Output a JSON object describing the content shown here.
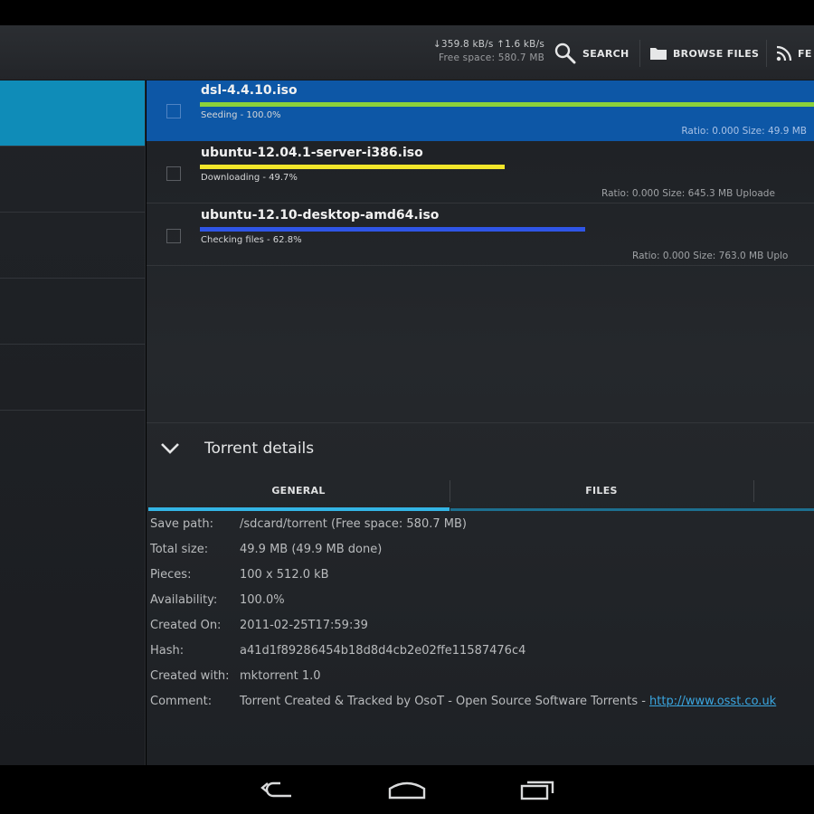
{
  "action_bar": {
    "speed": "↓359.8 kB/s ↑1.6 kB/s",
    "free_space": "Free space: 580.7 MB",
    "buttons": [
      {
        "label": "SEARCH",
        "icon": "search-icon"
      },
      {
        "label": "BROWSE FILES",
        "icon": "folder-icon"
      },
      {
        "label": "FE",
        "icon": "rss-feed-icon"
      }
    ]
  },
  "torrents": [
    {
      "name": "dsl-4.4.10.iso",
      "status": "Seeding - 100.0%",
      "meta": "Ratio: 0.000   Size: 49.9 MB",
      "progress": 1.0,
      "bar_color": "#8bd13a",
      "selected": true
    },
    {
      "name": "ubuntu-12.04.1-server-i386.iso",
      "status": "Downloading - 49.7%",
      "meta": "Ratio: 0.000   Size: 645.3 MB   Uploade",
      "progress": 0.497,
      "bar_color": "#f2e62a",
      "selected": false
    },
    {
      "name": "ubuntu-12.10-desktop-amd64.iso",
      "status": "Checking files - 62.8%",
      "meta": "Ratio: 0.000   Size: 763.0 MB   Uplo",
      "progress": 0.628,
      "bar_color": "#2f55e6",
      "selected": false
    }
  ],
  "details": {
    "title": "Torrent details",
    "tabs": [
      {
        "label": "GENERAL",
        "active": true
      },
      {
        "label": "FILES",
        "active": false
      }
    ],
    "rows": [
      {
        "label": "Save path:",
        "value": "/sdcard/torrent  (Free space: 580.7 MB)"
      },
      {
        "label": "Total size:",
        "value": "49.9 MB (49.9 MB done)"
      },
      {
        "label": "Pieces:",
        "value": "100 x 512.0 kB"
      },
      {
        "label": "Availability:",
        "value": "100.0%"
      },
      {
        "label": "Created On:",
        "value": "2011-02-25T17:59:39"
      },
      {
        "label": "Hash:",
        "value": "a41d1f89286454b18d8d4cb2e02ffe11587476c4"
      },
      {
        "label": "Created with:",
        "value": "mktorrent 1.0"
      },
      {
        "label": "Comment:",
        "value": "Torrent Created & Tracked by OsoT - Open Source Software Torrents - ",
        "link": "http://www.osst.co.uk"
      }
    ]
  },
  "colors": {
    "accent": "#0f8cb8",
    "selected_row": "#0d57a6",
    "tab_indicator": "#33b5e5"
  }
}
